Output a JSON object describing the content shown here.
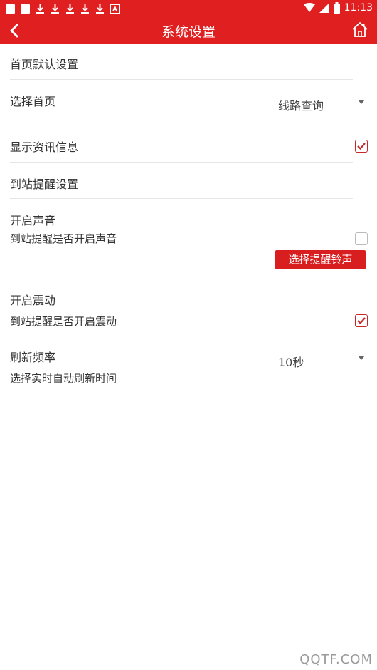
{
  "status_bar": {
    "time": "11:13",
    "icons": [
      "square-icon",
      "square-icon",
      "download-icon",
      "download-icon",
      "download-icon",
      "download-icon",
      "download-icon",
      "a-box-icon",
      "wifi-icon",
      "signal-icon",
      "battery-icon"
    ]
  },
  "app_bar": {
    "title": "系统设置",
    "back_icon": "back-icon",
    "home_icon": "home-icon"
  },
  "sections": {
    "homepage_default": "首页默认设置",
    "select_homepage": {
      "label": "选择首页",
      "value": "线路查询"
    },
    "show_news": {
      "label": "显示资讯信息",
      "checked": true
    },
    "arrival_reminder": "到站提醒设置",
    "sound": {
      "label": "开启声音",
      "desc": "到站提醒是否开启声音",
      "checked": false,
      "ringtone_button": "选择提醒铃声"
    },
    "vibrate": {
      "label": "开启震动",
      "desc": "到站提醒是否开启震动",
      "checked": true
    },
    "refresh": {
      "label": "刷新频率",
      "desc": "选择实时自动刷新时间",
      "value": "10秒"
    }
  },
  "watermark": "QQTF.COM",
  "colors": {
    "accent": "#e02020",
    "button": "#d81e1e",
    "checkbox_checked": "#c62828"
  }
}
